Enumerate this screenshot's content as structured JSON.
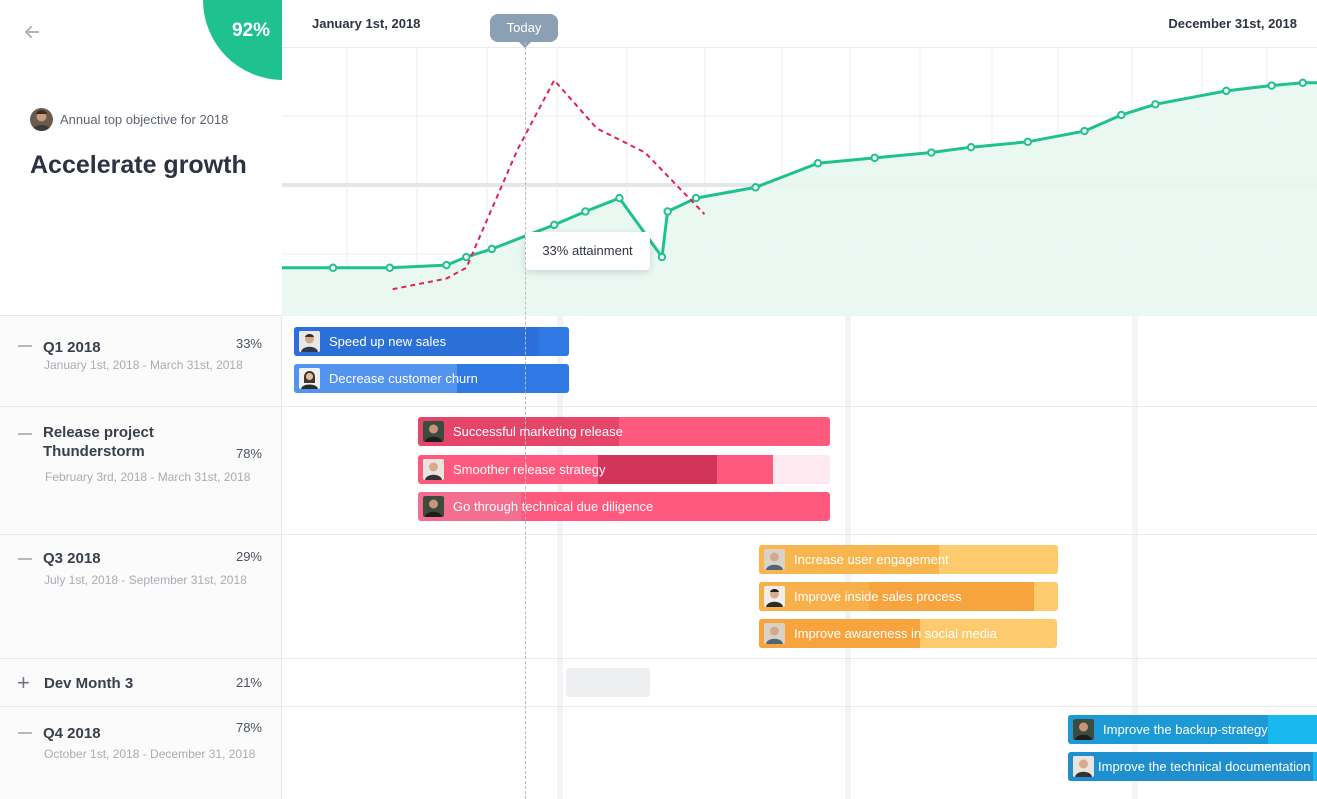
{
  "header": {
    "back_icon": "arrow-left-icon",
    "progress_percent": "92%",
    "owner_label": "Annual top objective for 2018",
    "objective_title": "Accelerate growth"
  },
  "timeline": {
    "start_label": "January 1st, 2018",
    "end_label": "December 31st, 2018",
    "today_label": "Today",
    "tooltip": "33% attainment"
  },
  "colors": {
    "green": "#1fc28f",
    "red_dashed": "#e0244e",
    "blue": "#2b7be4",
    "pink": "#ff5a7d",
    "orange": "#fcc56a",
    "cyan": "#19b9f0"
  },
  "chart_data": {
    "type": "line",
    "title": "",
    "xlabel": "",
    "ylabel": "",
    "xlim": [
      0,
      365
    ],
    "ylim": [
      0,
      100
    ],
    "x_range_labels": [
      "January 1st, 2018",
      "December 31st, 2018"
    ],
    "today_x": 63,
    "series": [
      {
        "style": "solid-green-area",
        "x": [
          0,
          18,
          38,
          58,
          65,
          74,
          96,
          107,
          119,
          134,
          136,
          146,
          167,
          189,
          209,
          229,
          243,
          263,
          283,
          296,
          308,
          333,
          349,
          360,
          365
        ],
        "y": [
          18,
          18,
          18,
          19,
          22,
          25,
          34,
          39,
          44,
          22,
          39,
          44,
          48,
          57,
          59,
          61,
          63,
          65,
          69,
          75,
          79,
          84,
          86,
          87,
          87
        ]
      },
      {
        "style": "dashed-red",
        "x": [
          39,
          58,
          65,
          83,
          96,
          111,
          128,
          149
        ],
        "y": [
          10,
          14,
          18,
          62,
          88,
          70,
          61,
          38
        ]
      }
    ]
  },
  "groups": [
    {
      "title": "Q1 2018",
      "percent": "33%",
      "dates": "January 1st, 2018 - March 31st, 2018",
      "items": [
        {
          "label": "Speed up new sales",
          "progress": 0.89
        },
        {
          "label": "Decrease customer churn",
          "progress": 0.6
        }
      ]
    },
    {
      "title": "Release project Thunderstorm",
      "percent": "78%",
      "dates": "February 3rd, 2018 - March 31st, 2018",
      "items": [
        {
          "label": "Successful marketing release",
          "progress": 0.49
        },
        {
          "label": "Smoother release strategy",
          "progress": 0.73
        },
        {
          "label": "Go through technical due diligence",
          "progress": 0.25
        }
      ]
    },
    {
      "title": "Q3 2018",
      "percent": "29%",
      "dates": "July 1st, 2018 - September 31st, 2018",
      "items": [
        {
          "label": "Increase user engagement",
          "progress": 0.6
        },
        {
          "label": "Improve inside sales process",
          "progress": 0.92
        },
        {
          "label": "Improve awareness in social media",
          "progress": 0.54
        }
      ]
    },
    {
      "title": "Dev Month 3",
      "percent": "21%",
      "collapsed": true
    },
    {
      "title": "Q4 2018",
      "percent": "78%",
      "dates": "October 1st, 2018 - December 31, 2018",
      "items": [
        {
          "label": "Improve the backup-strategy",
          "progress": 0.8
        },
        {
          "label": "Improve the technical documentation",
          "progress": 0.98
        }
      ]
    }
  ]
}
